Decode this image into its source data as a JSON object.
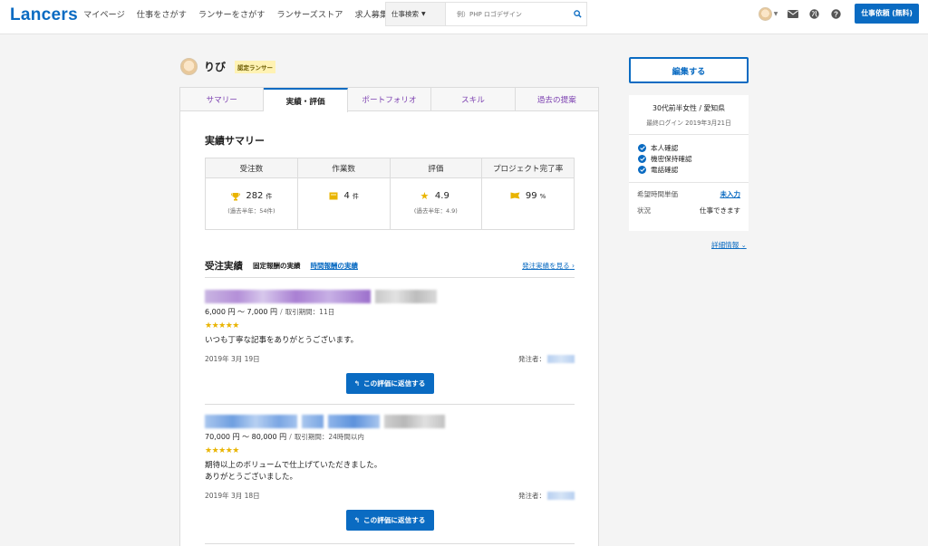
{
  "header": {
    "logo": "Lancers",
    "nav": [
      "マイページ",
      "仕事をさがす",
      "ランサーをさがす",
      "ランサーズストア",
      "求人募集"
    ],
    "search": {
      "category": "仕事検索",
      "placeholder": "例）PHP ロゴデザイン"
    },
    "order_button": "仕事依頼 (無料)"
  },
  "profile": {
    "name": "りび",
    "badge": "認定ランサー"
  },
  "tabs": [
    "サマリー",
    "実績・評価",
    "ポートフォリオ",
    "スキル",
    "過去の提案"
  ],
  "summary": {
    "title": "実績サマリー",
    "columns": [
      {
        "header": "受注数",
        "value": "282",
        "unit": "件",
        "sub": "(過去半年：54件)"
      },
      {
        "header": "作業数",
        "value": "4",
        "unit": "件",
        "sub": ""
      },
      {
        "header": "評価",
        "value": "4.9",
        "unit": "",
        "sub": "(過去半年：4.9)"
      },
      {
        "header": "プロジェクト完了率",
        "value": "99",
        "unit": "%",
        "sub": ""
      }
    ]
  },
  "jobs": {
    "title": "受注実績",
    "tab_fixed": "固定報酬の実績",
    "tab_hourly": "時間報酬の実績",
    "link": "発注実績を見る",
    "client_label": "発注者：",
    "reply_button": "この評価に返信する",
    "items": [
      {
        "price": "6,000 円 〜 7,000 円",
        "sep": "/",
        "period": "取引期間：11日",
        "stars": "★★★★★",
        "comment_lines": [
          "いつも丁寧な記事をありがとうございます。"
        ],
        "date": "2019年 3月 19日"
      },
      {
        "price": "70,000 円 〜 80,000 円",
        "sep": "/",
        "period": "取引期間：24時間以内",
        "stars": "★★★★★",
        "comment_lines": [
          "期待以上のボリュームで仕上げていただきました。",
          "ありがとうございました。"
        ],
        "date": "2019年 3月 18日"
      }
    ]
  },
  "sidebar": {
    "edit_button": "編集する",
    "profile_line": "30代前半女性 / 愛知県",
    "last_login": "最終ログイン 2019年3月21日",
    "checks": [
      "本人確認",
      "機密保持確認",
      "電話確認"
    ],
    "rows": [
      {
        "label": "希望時間単価",
        "value": "未入力"
      },
      {
        "label": "状況",
        "value": "仕事できます"
      }
    ],
    "details_link": "詳細情報"
  },
  "colors": {
    "accent": "#0a6bc2",
    "tab_link": "#7b3fb0",
    "star": "#e9b400",
    "badge_bg": "#fff2b3"
  }
}
